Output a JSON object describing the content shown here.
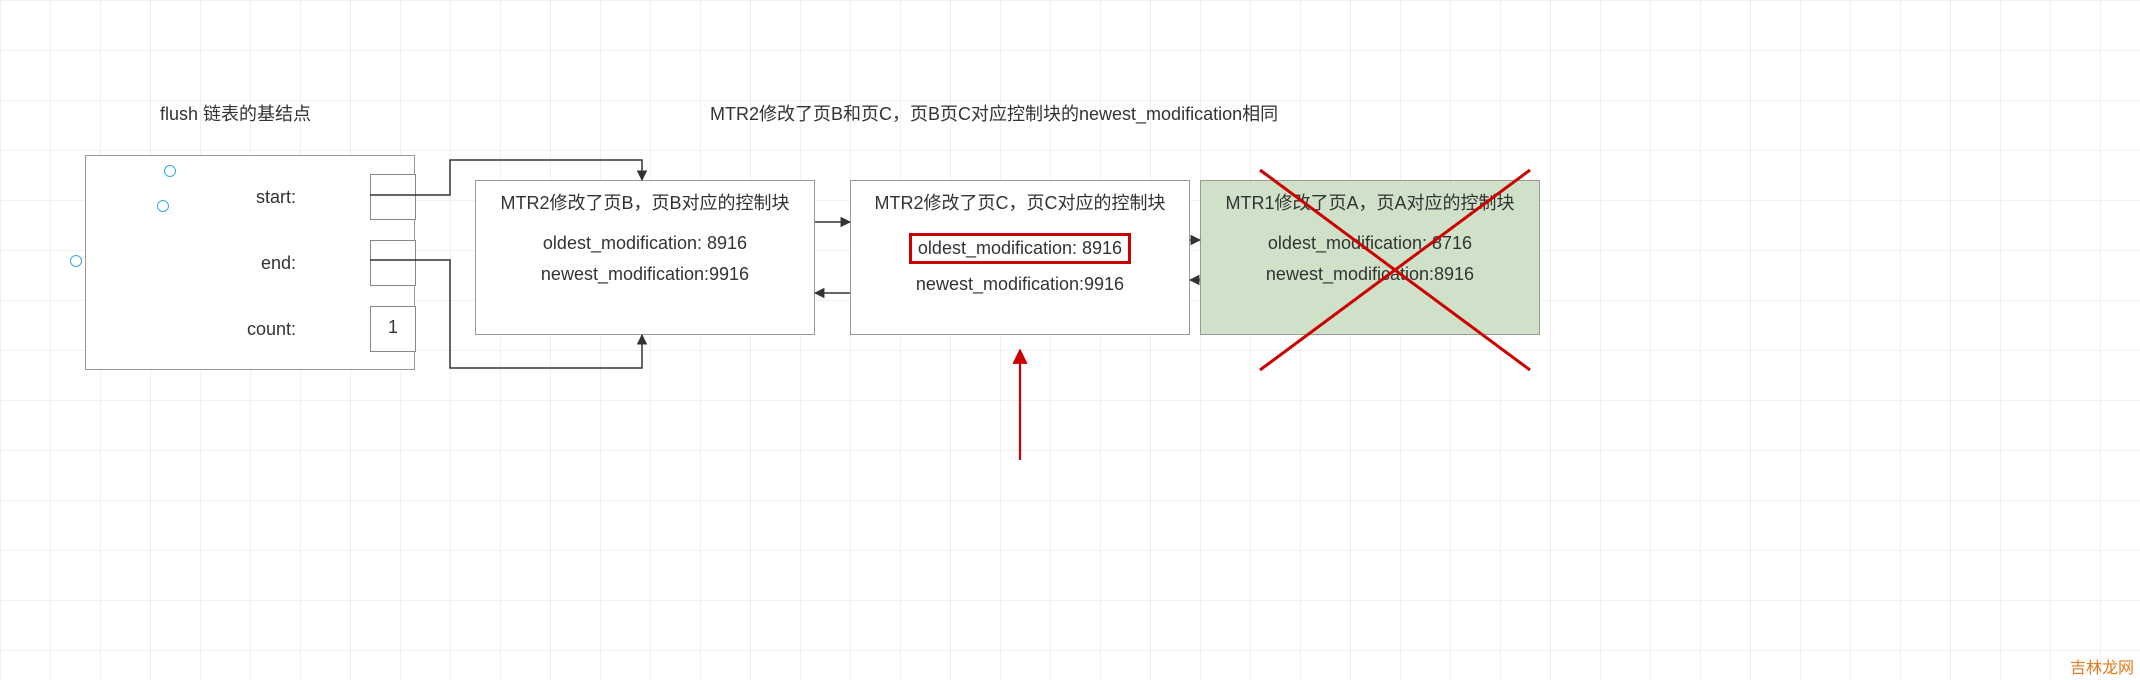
{
  "caption_left": "flush 链表的基结点",
  "caption_top": "MTR2修改了页B和页C，页B页C对应控制块的newest_modification相同",
  "base_node": {
    "start_label": "start:",
    "end_label": "end:",
    "count_label": "count:",
    "count_value": "1"
  },
  "block_b": {
    "title": "MTR2修改了页B，页B对应的控制块",
    "oldest": "oldest_modification: 8916",
    "newest": "newest_modification:9916"
  },
  "block_c": {
    "title": "MTR2修改了页C，页C对应的控制块",
    "oldest": "oldest_modification: 8916",
    "newest": "newest_modification:9916"
  },
  "block_a": {
    "title": "MTR1修改了页A，页A对应的控制块",
    "oldest": "oldest_modification: 8716",
    "newest": "newest_modification:8916"
  },
  "watermark": "吉林龙网"
}
